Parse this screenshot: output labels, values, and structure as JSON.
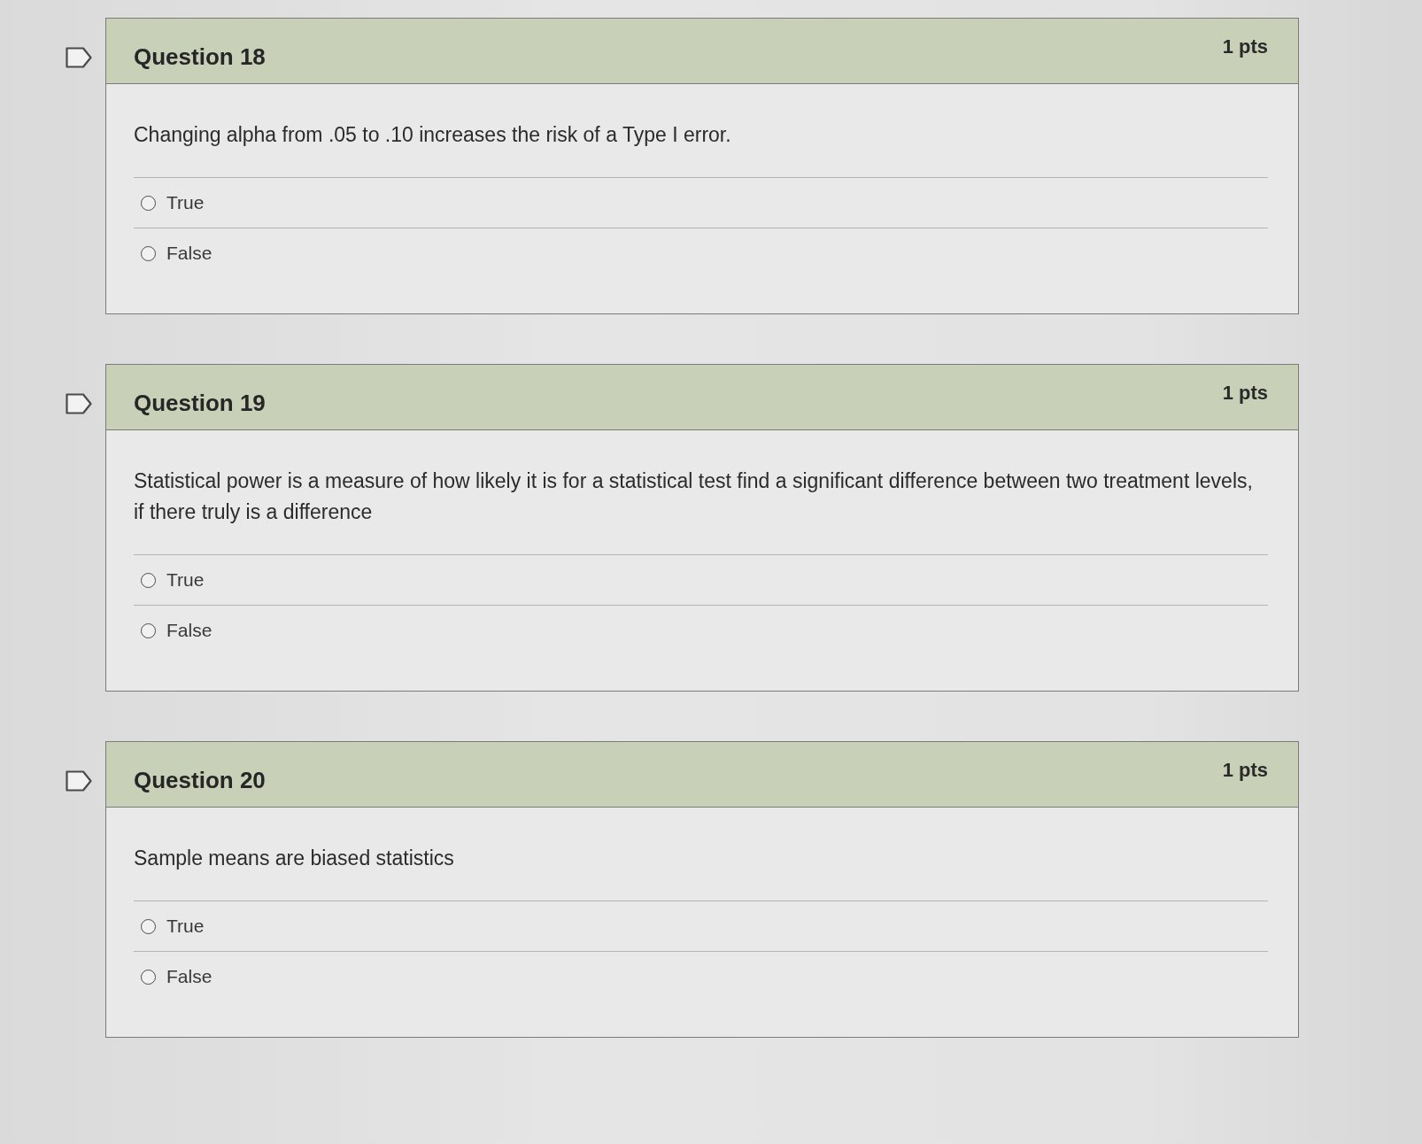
{
  "questions": [
    {
      "title": "Question 18",
      "points": "1 pts",
      "flagged": false,
      "text": "Changing alpha from .05 to .10 increases the risk of a Type I error.",
      "answers": [
        {
          "label": "True",
          "selected": false
        },
        {
          "label": "False",
          "selected": false
        }
      ]
    },
    {
      "title": "Question 19",
      "points": "1 pts",
      "flagged": false,
      "text": "Statistical power is a measure of how likely it is for a statistical test find a significant difference between two treatment levels, if there truly is a difference",
      "answers": [
        {
          "label": "True",
          "selected": false
        },
        {
          "label": "False",
          "selected": false
        }
      ]
    },
    {
      "title": "Question 20",
      "points": "1 pts",
      "flagged": false,
      "text": "Sample means are biased statistics",
      "answers": [
        {
          "label": "True",
          "selected": false
        },
        {
          "label": "False",
          "selected": false
        }
      ]
    }
  ]
}
